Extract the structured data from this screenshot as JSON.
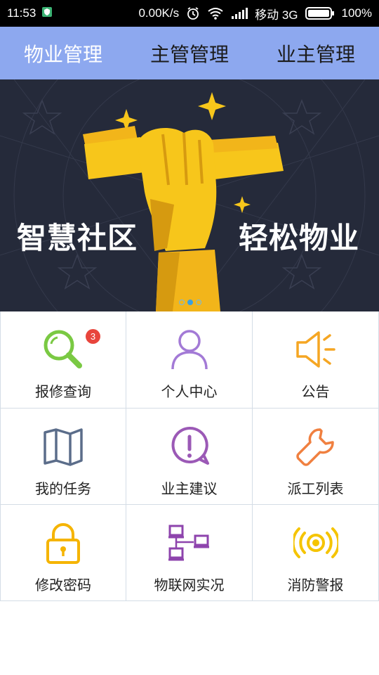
{
  "status_bar": {
    "time": "11:53",
    "speed": "0.00K/s",
    "carrier": "移动",
    "network": "3G",
    "battery": "100%"
  },
  "tabs": [
    {
      "label": "物业管理",
      "active": true
    },
    {
      "label": "主管管理",
      "active": false
    },
    {
      "label": "业主管理",
      "active": false
    }
  ],
  "banner": {
    "left_text": "智慧社区",
    "right_text": "轻松物业",
    "page_count": 3,
    "current_page": 2
  },
  "menu": {
    "items": [
      {
        "label": "报修查询",
        "icon": "search-icon",
        "color": "#7ac943",
        "badge": "3"
      },
      {
        "label": "个人中心",
        "icon": "user-icon",
        "color": "#a37ad6"
      },
      {
        "label": "公告",
        "icon": "speaker-icon",
        "color": "#f5a623"
      },
      {
        "label": "我的任务",
        "icon": "map-icon",
        "color": "#5b6d8a"
      },
      {
        "label": "业主建议",
        "icon": "alert-bubble-icon",
        "color": "#9b59b6"
      },
      {
        "label": "派工列表",
        "icon": "wrench-icon",
        "color": "#f08040"
      },
      {
        "label": "修改密码",
        "icon": "lock-icon",
        "color": "#f5b400"
      },
      {
        "label": "物联网实况",
        "icon": "network-icon",
        "color": "#8e44ad"
      },
      {
        "label": "消防警报",
        "icon": "alarm-icon",
        "color": "#f5c400"
      }
    ]
  }
}
